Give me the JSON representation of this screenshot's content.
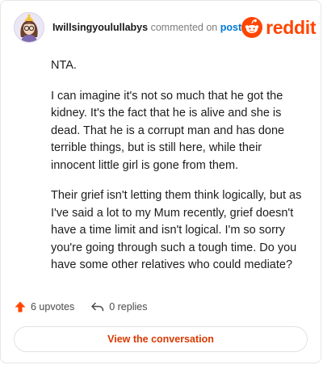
{
  "header": {
    "username": "Iwillsingyoulullabys",
    "commented_on": "commented on",
    "post_link": "post",
    "brand": "reddit"
  },
  "comment": {
    "paragraphs": [
      "NTA.",
      "I can imagine it's not so much that he got the kidney. It's the fact that he is alive and she is dead. That he is a corrupt man and has done terrible things, but is still here, while their innocent little girl is gone from them.",
      "Their grief isn't letting them think logically, but as I've said a lot to my Mum recently, grief doesn't have a time limit and isn't logical. I'm so sorry you're going through such a tough time. Do you have some other relatives who could mediate?"
    ]
  },
  "actions": {
    "upvotes": "6 upvotes",
    "replies": "0 replies"
  },
  "cta": {
    "label": "View the conversation"
  },
  "colors": {
    "accent": "#ff4500",
    "link": "#0079d3",
    "cta_text": "#d93900"
  }
}
